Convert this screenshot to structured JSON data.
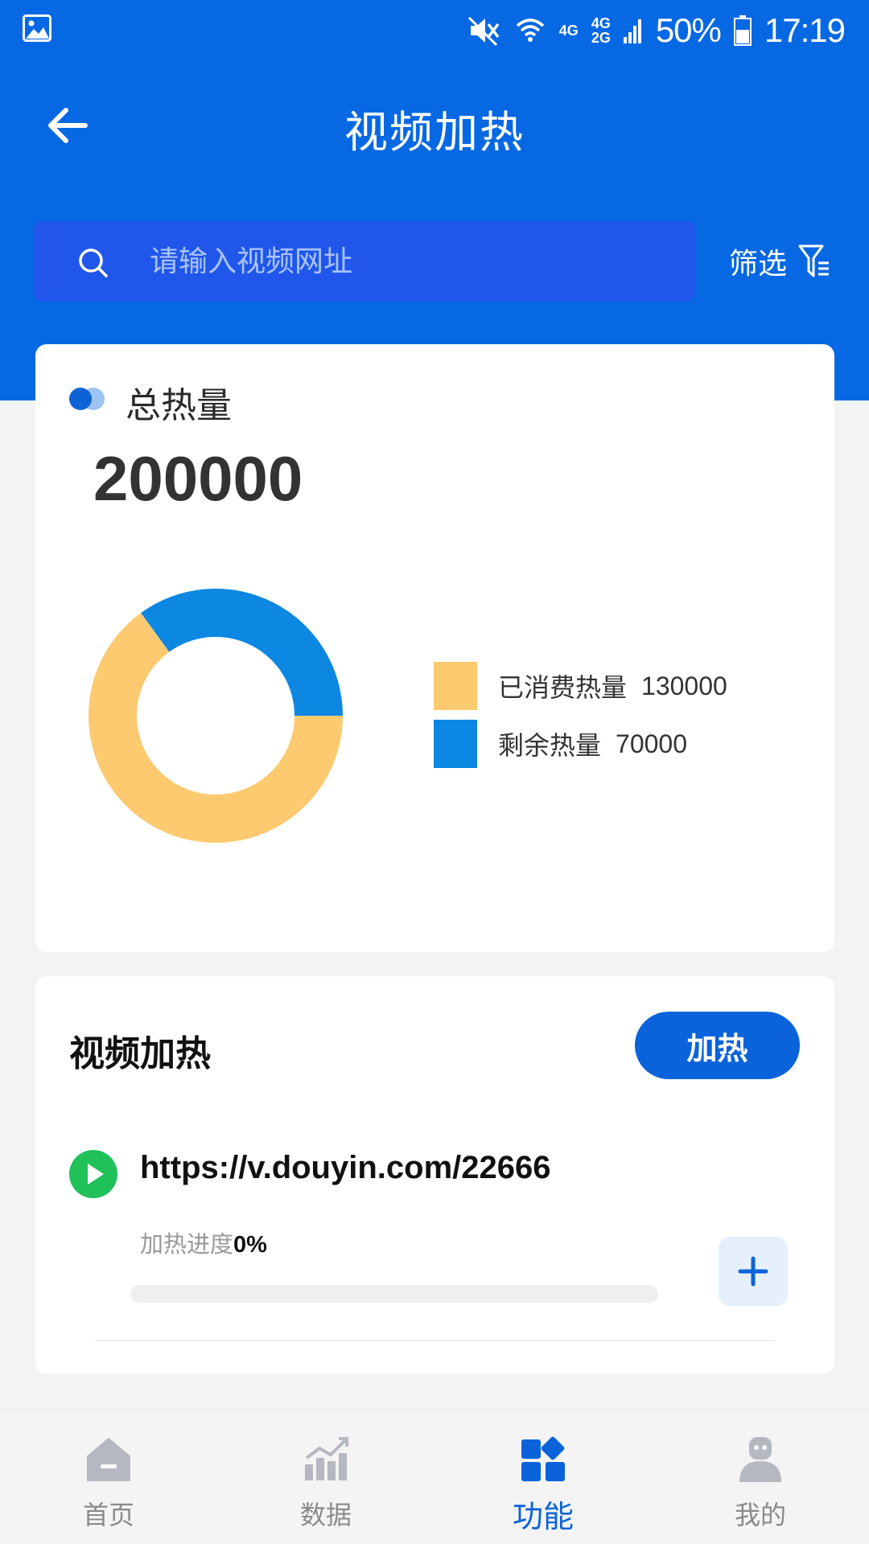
{
  "status_bar": {
    "battery": "50%",
    "time": "17:19",
    "net1": "4G",
    "net2": "4G",
    "net3": "2G"
  },
  "header": {
    "title": "视频加热"
  },
  "search": {
    "placeholder": "请输入视频网址",
    "filter_label": "筛选"
  },
  "total_heat": {
    "label": "总热量",
    "value": "200000",
    "legend": [
      {
        "label": "已消费热量",
        "value": "130000",
        "color": "#fdca70"
      },
      {
        "label": "剩余热量",
        "value": "70000",
        "color": "#0c87e2"
      }
    ]
  },
  "chart_data": {
    "type": "pie",
    "categories": [
      "已消费热量",
      "剩余热量"
    ],
    "values": [
      130000,
      70000
    ],
    "colors": [
      "#fdca70",
      "#0c87e2"
    ],
    "donut": true
  },
  "video_heat": {
    "title": "视频加热",
    "heat_button": "加热",
    "items": [
      {
        "url": "https://v.douyin.com/22666",
        "progress_label": "加热进度",
        "progress_value": "0%",
        "progress": 0
      }
    ]
  },
  "nav": {
    "items": [
      {
        "label": "首页",
        "icon": "home-icon",
        "active": false
      },
      {
        "label": "数据",
        "icon": "chart-icon",
        "active": false
      },
      {
        "label": "功能",
        "icon": "function-icon",
        "active": true
      },
      {
        "label": "我的",
        "icon": "user-icon",
        "active": false
      }
    ],
    "active_color": "#0a63da"
  },
  "colors": {
    "primary": "#0768e3",
    "search_bg": "#2057ea",
    "play_green": "#21c15a"
  }
}
